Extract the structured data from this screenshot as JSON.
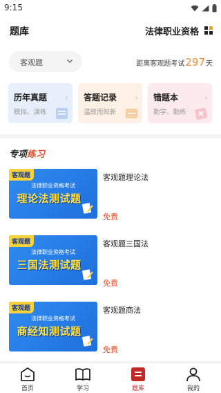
{
  "status": {
    "time": "9:15"
  },
  "header": {
    "title": "题库",
    "qualification": "法律职业资格"
  },
  "selector": {
    "value": "客观题"
  },
  "countdown": {
    "prefix": "距离客观题考试",
    "days": "297",
    "suffix": "天"
  },
  "cards": [
    {
      "title": "历年真题",
      "subtitle": "模拟、演练"
    },
    {
      "title": "答题记录",
      "subtitle": "温故而知新"
    },
    {
      "title": "错题本",
      "subtitle": "勤学、勤练"
    }
  ],
  "section": {
    "title_a": "专项",
    "title_b": "练习"
  },
  "items": [
    {
      "tag": "客观题",
      "banner_sub": "法律职业资格考试",
      "banner_title": "理论法测试题",
      "name": "客观题理论法",
      "price": "免费"
    },
    {
      "tag": "客观题",
      "banner_sub": "法律职业资格考试",
      "banner_title": "三国法测试题",
      "name": "客观题三国法",
      "price": "免费"
    },
    {
      "tag": "客观题",
      "banner_sub": "法律职业资格考试",
      "banner_title": "商经知测试题",
      "name": "客观题商法",
      "price": "免费"
    }
  ],
  "nav": [
    {
      "label": "首页",
      "icon": "home-icon"
    },
    {
      "label": "学习",
      "icon": "book-icon"
    },
    {
      "label": "题库",
      "icon": "question-bank-icon",
      "active": true
    },
    {
      "label": "我的",
      "icon": "profile-icon"
    }
  ],
  "colors": {
    "accent": "#e4502c",
    "countdown": "#f08c2c",
    "active_nav": "#c62828"
  }
}
